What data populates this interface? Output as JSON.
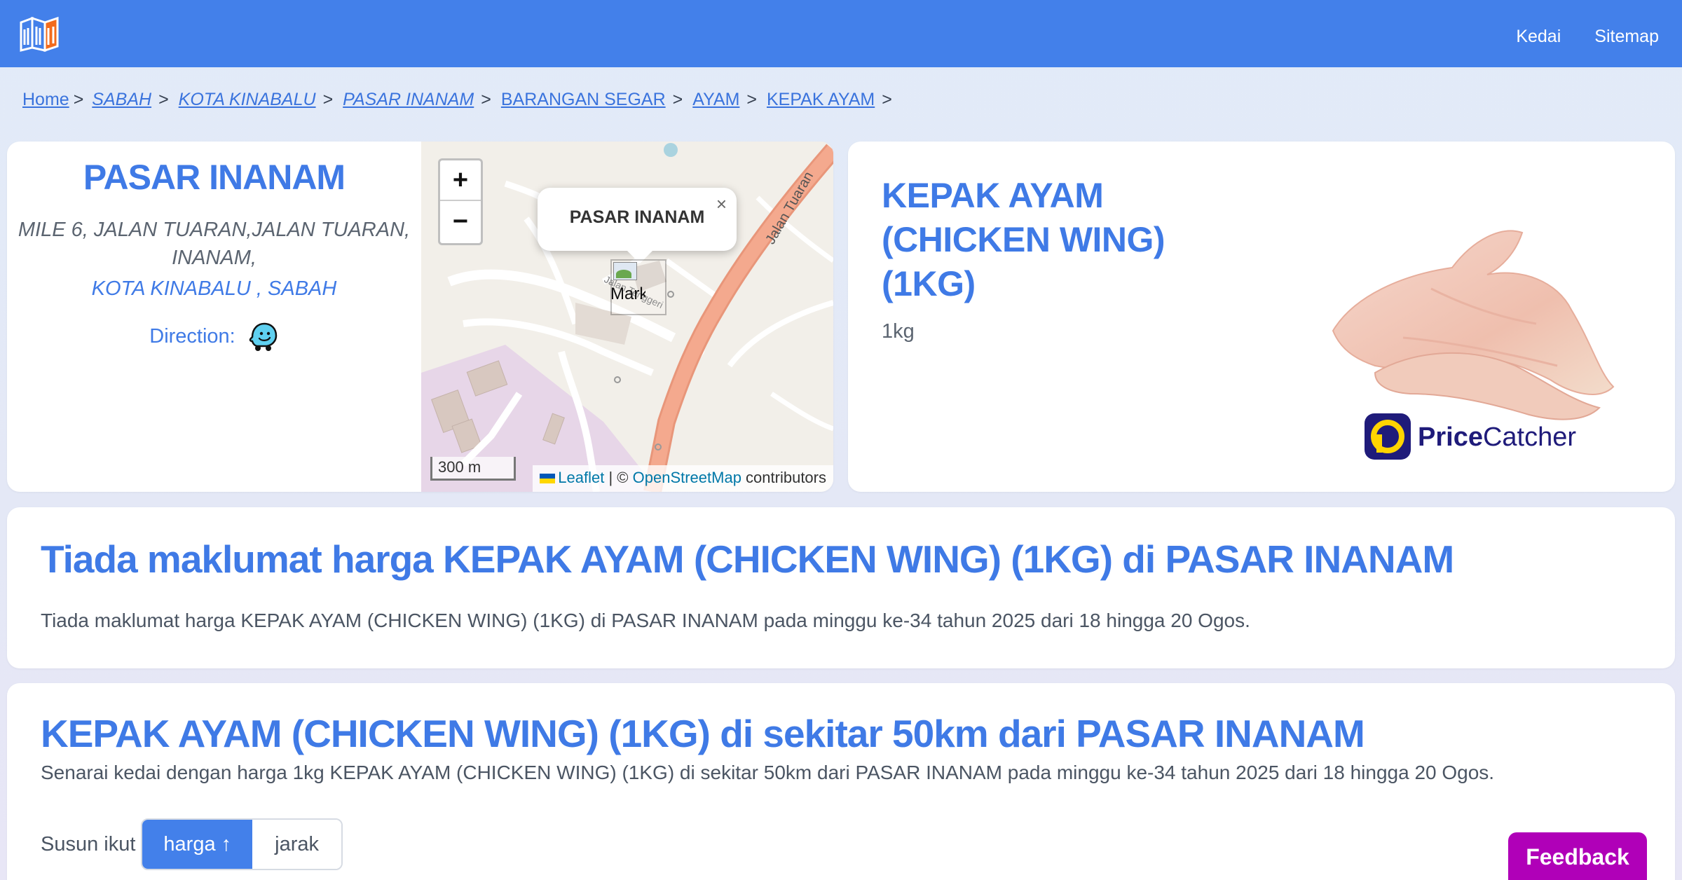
{
  "header": {
    "logo_alt": "site-logo",
    "nav": [
      {
        "label": "Kedai"
      },
      {
        "label": "Sitemap"
      }
    ],
    "colors": {
      "bar": "#4380ea"
    }
  },
  "breadcrumb": {
    "home": "Home",
    "items": [
      "SABAH",
      "KOTA KINABALU",
      "PASAR INANAM",
      "BARANGAN SEGAR",
      "AYAM",
      "KEPAK AYAM"
    ],
    "separator": ">"
  },
  "market": {
    "name": "PASAR INANAM",
    "address": "MILE 6, JALAN TUARAN,JALAN TUARAN, INANAM,",
    "city": "KOTA KINABALU",
    "city_sep": " , ",
    "state": "SABAH",
    "direction_label": "Direction:",
    "direction_icon": "waze-icon"
  },
  "map": {
    "zoom_in": "+",
    "zoom_out": "−",
    "popup_title": "PASAR INANAM",
    "popup_close": "×",
    "marker_label": "Marker",
    "scale": "300 m",
    "attribution_leaflet": "Leaflet",
    "attribution_sep": " | © ",
    "attribution_osm": "OpenStreetMap",
    "attribution_tail": " contributors",
    "road_label": "Jalan Tuaran",
    "road_label_small": "Jalan Tenggeri"
  },
  "product": {
    "name": "KEPAK AYAM (CHICKEN WING) (1KG)",
    "unit": "1kg",
    "brand": "PriceCatcher",
    "brand_bold": "Price",
    "brand_rest": "Catcher"
  },
  "info": {
    "title": "Tiada maklumat harga KEPAK AYAM (CHICKEN WING) (1KG) di PASAR INANAM",
    "text": "Tiada maklumat harga KEPAK AYAM (CHICKEN WING) (1KG) di PASAR INANAM pada minggu ke-34 tahun 2025 dari 18 hingga 20 Ogos."
  },
  "nearby": {
    "title": "KEPAK AYAM (CHICKEN WING) (1KG) di sekitar 50km dari PASAR INANAM",
    "text": "Senarai kedai dengan harga 1kg KEPAK AYAM (CHICKEN WING) (1KG) di sekitar 50km dari PASAR INANAM pada minggu ke-34 tahun 2025 dari 18 hingga 20 Ogos.",
    "sort_label": "Susun ikut",
    "sort_options": [
      {
        "label": "harga ↑",
        "active": true
      },
      {
        "label": "jarak",
        "active": false
      }
    ]
  },
  "feedback": {
    "label": "Feedback",
    "color": "#b000b8"
  }
}
